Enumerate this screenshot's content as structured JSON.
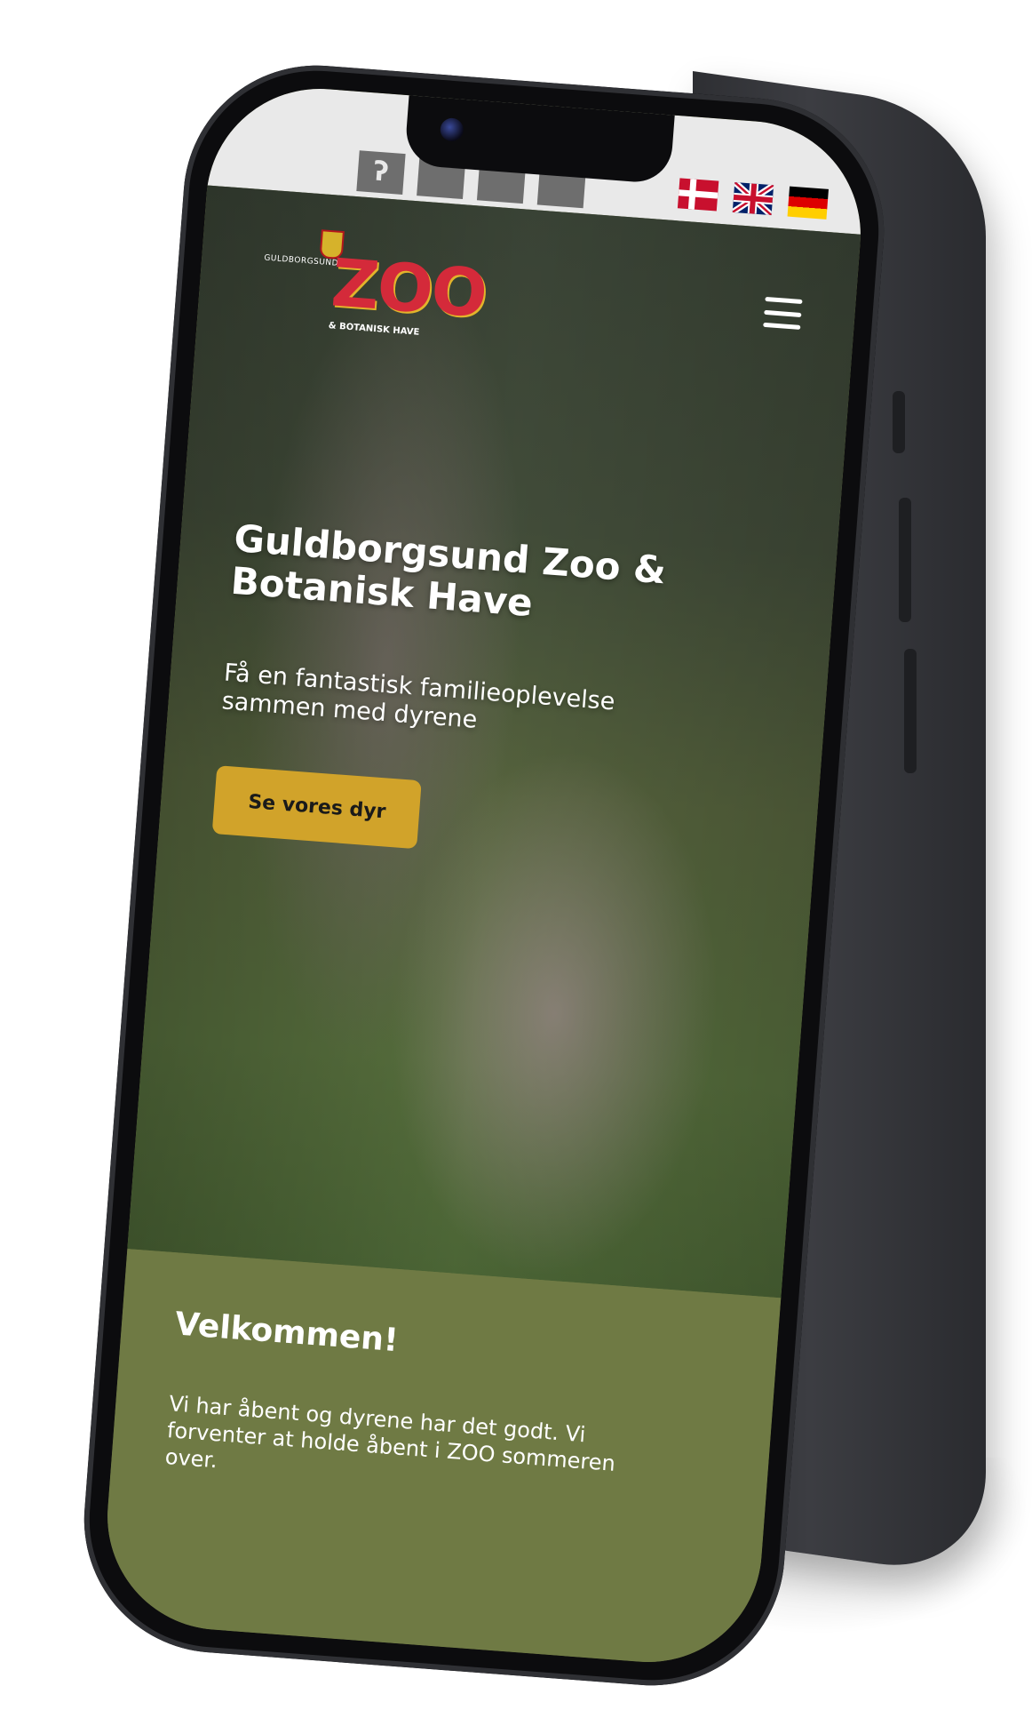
{
  "top_bar": {
    "accessibility_button": "ear-icon",
    "flags": [
      "flag-dk-icon",
      "flag-uk-icon",
      "flag-de-icon"
    ]
  },
  "header": {
    "logo_small": "GULDBORGSUND",
    "logo_main": "ZOO",
    "logo_sub": "& BOTANISK HAVE",
    "menu_icon": "hamburger-menu-icon"
  },
  "hero": {
    "title": "Guldborgsund Zoo & Botanisk Have",
    "subtitle": "Få en fantastisk familieoplevelse sammen med dyrene",
    "cta_label": "Se vores dyr"
  },
  "welcome": {
    "title": "Velkommen!",
    "text": "Vi har åbent og dyrene har det godt. Vi forventer at holde åbent i ZOO sommeren over."
  },
  "colors": {
    "accent": "#d1a32a",
    "section_green": "#6f7a44",
    "logo_red": "#d42a3a"
  }
}
